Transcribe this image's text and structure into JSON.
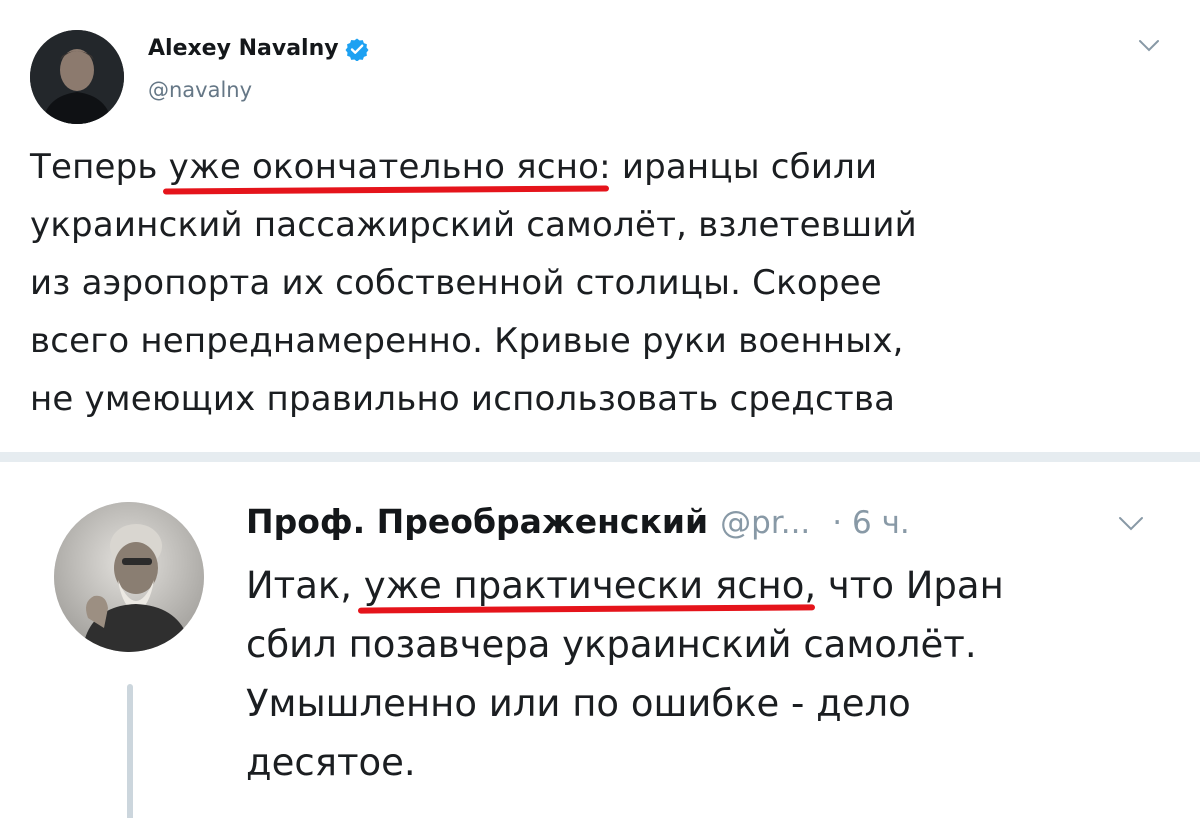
{
  "tweet1": {
    "author_name": "Alexey Navalny",
    "handle": "@navalny",
    "verified": true,
    "text_lines": [
      {
        "before": "Теперь ",
        "highlight": "уже окончательно ясно",
        "after": ": иранцы сбили"
      },
      {
        "before": "украинский пассажирский самолёт, взлетевший",
        "highlight": "",
        "after": ""
      },
      {
        "before": "из аэропорта их собственной столицы. Скорее",
        "highlight": "",
        "after": ""
      },
      {
        "before": "всего непреднамеренно. Кривые руки военных,",
        "highlight": "",
        "after": ""
      },
      {
        "before": "не умеющих правильно использовать средства",
        "highlight": "",
        "after": ""
      }
    ]
  },
  "tweet2": {
    "author_name": "Проф. Преображенский",
    "handle": "@pr...",
    "time": "· 6 ч.",
    "text_lines": [
      {
        "before": "Итак, ",
        "highlight": "уже практически ясно",
        "after": ", что Иран"
      },
      {
        "before": "сбил позавчера украинский самолёт.",
        "highlight": "",
        "after": ""
      },
      {
        "before": "Умышленно или по ошибке - дело",
        "highlight": "",
        "after": ""
      },
      {
        "before": "десятое.",
        "highlight": "",
        "after": ""
      }
    ]
  },
  "colors": {
    "verified_blue": "#1da1f2",
    "handle_gray": "#657786",
    "underline_red": "#e5141b",
    "divider": "#e6ecf0",
    "thread_line": "#ccd6dd"
  },
  "icons": {
    "verified": "verified-badge-icon",
    "menu": "chevron-down-icon"
  }
}
